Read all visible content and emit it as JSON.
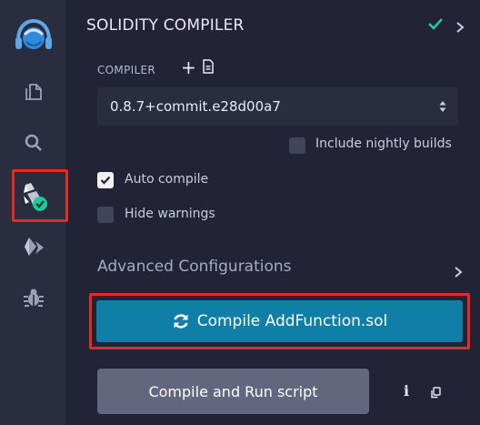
{
  "panel": {
    "title": "SOLIDITY COMPILER",
    "compiler_label": "COMPILER",
    "compiler_version": "0.8.7+commit.e28d00a7",
    "nightly_label": "Include nightly builds",
    "nightly_checked": false,
    "auto_compile_label": "Auto compile",
    "auto_compile_checked": true,
    "hide_warnings_label": "Hide warnings",
    "hide_warnings_checked": false,
    "advanced_label": "Advanced Configurations",
    "compile_button_label": "Compile AddFunction.sol",
    "run_script_label": "Compile and Run script"
  },
  "icons": {
    "rail": [
      "remix-logo-icon",
      "file-explorer-icon",
      "search-icon",
      "solidity-compiler-icon",
      "deploy-run-icon",
      "debugger-icon"
    ],
    "title_status": "check-icon",
    "title_expand": "chevron-right-icon",
    "info": "info-icon",
    "copy": "copy-icon"
  },
  "colors": {
    "accent": "#0f7fa8",
    "success": "#20c997",
    "highlight": "#e12c22",
    "run_button": "#63667f"
  }
}
